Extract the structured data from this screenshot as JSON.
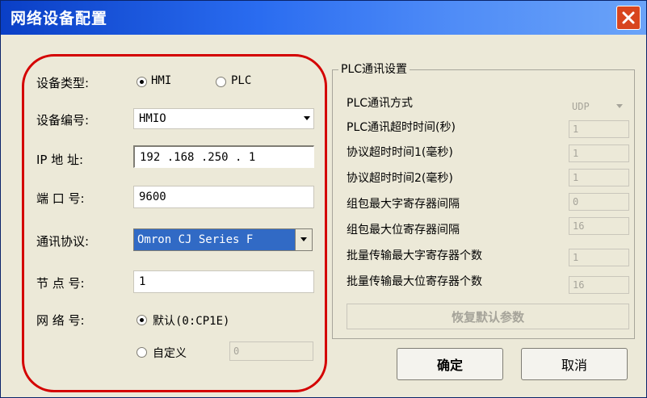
{
  "window": {
    "title": "网络设备配置"
  },
  "device_type": {
    "label": "设备类型:",
    "options": [
      "HMI",
      "PLC"
    ],
    "selected": "HMI"
  },
  "device_id": {
    "label": "设备编号:",
    "value": "HMIO"
  },
  "ip": {
    "label": "IP 地 址:",
    "value": "192 .168 .250 . 1"
  },
  "port": {
    "label": "端 口 号:",
    "value": "9600"
  },
  "protocol": {
    "label": "通讯协议:",
    "value": "Omron CJ Series F"
  },
  "node": {
    "label": "节 点 号:",
    "value": "1"
  },
  "network": {
    "label": "网 络 号:",
    "default_option": "默认(0:CP1E)",
    "custom_option": "自定义",
    "custom_value": "0",
    "selected": "default"
  },
  "plc_comm": {
    "group_title": "PLC通讯设置",
    "rows": [
      {
        "label": "PLC通讯方式",
        "value": "UDP"
      },
      {
        "label": "PLC通讯超时时间(秒)",
        "value": "1"
      },
      {
        "label": "协议超时时间1(毫秒)",
        "value": "1"
      },
      {
        "label": "协议超时时间2(毫秒)",
        "value": "1"
      },
      {
        "label": "组包最大字寄存器间隔",
        "value": "0"
      },
      {
        "label": "组包最大位寄存器间隔",
        "value": "16"
      },
      {
        "label": "批量传输最大字寄存器个数",
        "value": "1"
      },
      {
        "label": "批量传输最大位寄存器个数",
        "value": "16"
      }
    ],
    "restore_label": "恢复默认参数"
  },
  "buttons": {
    "ok": "确定",
    "cancel": "取消"
  },
  "colors": {
    "title_bar": "#2a6cf0",
    "window_bg": "#ece9d8",
    "close_button": "#d8451e",
    "highlight_oval": "#d40000",
    "selection": "#316ac5"
  }
}
